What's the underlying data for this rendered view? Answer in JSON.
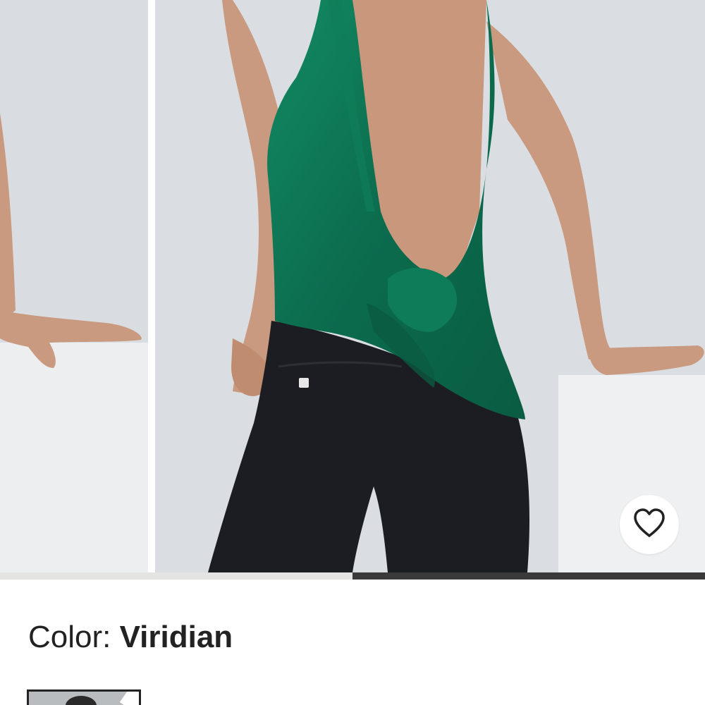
{
  "gallery": {
    "total_images": 2,
    "current_index": 2,
    "progress_fraction": 0.5
  },
  "favorite": {
    "icon": "heart-outline-icon"
  },
  "color": {
    "label": "Color: ",
    "value": "Viridian"
  },
  "colors": {
    "product": "#0b6b4d",
    "leggings": "#1c1d22",
    "backdrop": "#dadee2",
    "progress_track": "#e4e5e2",
    "progress_active": "#3a3a3a",
    "text": "#222222"
  }
}
